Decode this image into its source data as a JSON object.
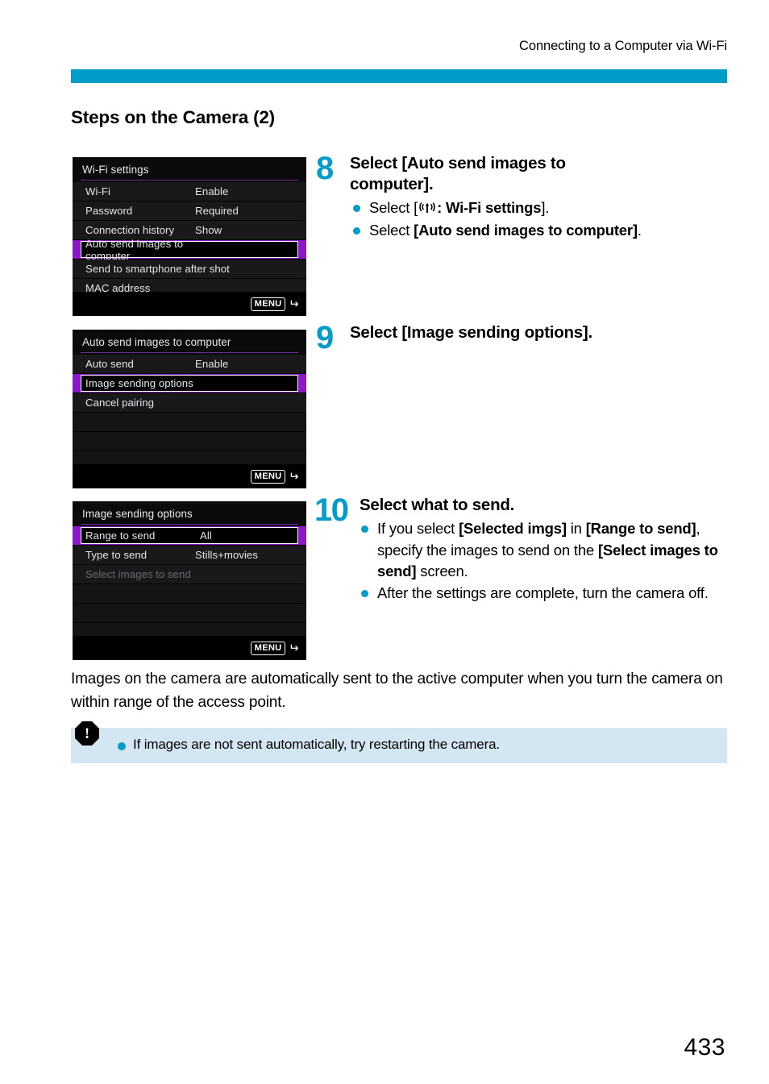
{
  "header": {
    "running_head": "Connecting to a Computer via Wi-Fi",
    "accent_color": "#029cc9"
  },
  "section": {
    "title": "Steps on the Camera (2)"
  },
  "screens": [
    {
      "title": "Wi-Fi settings",
      "rows": [
        {
          "label": "Wi-Fi",
          "value": "Enable",
          "state": "normal"
        },
        {
          "label": "Password",
          "value": "Required",
          "state": "normal"
        },
        {
          "label": "Connection history",
          "value": "Show",
          "state": "normal"
        },
        {
          "label": "Auto send images to computer",
          "value": "",
          "state": "selected"
        },
        {
          "label": "Send to smartphone after shot",
          "value": "",
          "state": "normal"
        },
        {
          "label": "MAC address",
          "value": "",
          "state": "normal"
        }
      ],
      "menu_button": "MENU",
      "menu_arrow": "return-arrow-icon"
    },
    {
      "title": "Auto send images to computer",
      "rows": [
        {
          "label": "Auto send",
          "value": "Enable",
          "state": "normal"
        },
        {
          "label": "Image sending options",
          "value": "",
          "state": "selected"
        },
        {
          "label": "Cancel pairing",
          "value": "",
          "state": "normal"
        },
        {
          "label": "",
          "value": "",
          "state": "empty"
        },
        {
          "label": "",
          "value": "",
          "state": "empty"
        },
        {
          "label": "",
          "value": "",
          "state": "empty"
        }
      ],
      "menu_button": "MENU",
      "menu_arrow": "return-arrow-icon"
    },
    {
      "title": "Image sending options",
      "rows": [
        {
          "label": "Range to send",
          "value": "All",
          "state": "selected"
        },
        {
          "label": "Type to send",
          "value": "Stills+movies",
          "state": "normal"
        },
        {
          "label": "Select images to send",
          "value": "",
          "state": "disabled"
        },
        {
          "label": "",
          "value": "",
          "state": "empty"
        },
        {
          "label": "",
          "value": "",
          "state": "empty"
        },
        {
          "label": "",
          "value": "",
          "state": "empty"
        }
      ],
      "menu_button": "MENU",
      "menu_arrow": "return-arrow-icon"
    }
  ],
  "steps": [
    {
      "number": "8",
      "heading": "Select [Auto send images to computer].",
      "bullets": [
        "Select [(wifi): Wi-Fi settings].",
        "Select [Auto send images to computer]."
      ]
    },
    {
      "number": "9",
      "heading": "Select [Image sending options].",
      "bullets": []
    },
    {
      "number": "10",
      "heading": "Select what to send.",
      "bullets": [
        "If you select [Selected imgs] in [Range to send], specify the images to send on the [Select images to send] screen.",
        "After the settings are complete, turn the camera off."
      ]
    }
  ],
  "body_paragraph": "Images on the camera are automatically sent to the active computer when you turn the camera on within range of the access point.",
  "note": {
    "icon": "caution-icon",
    "text": "If images are not sent automatically, try restarting the camera."
  },
  "page_number": "433"
}
